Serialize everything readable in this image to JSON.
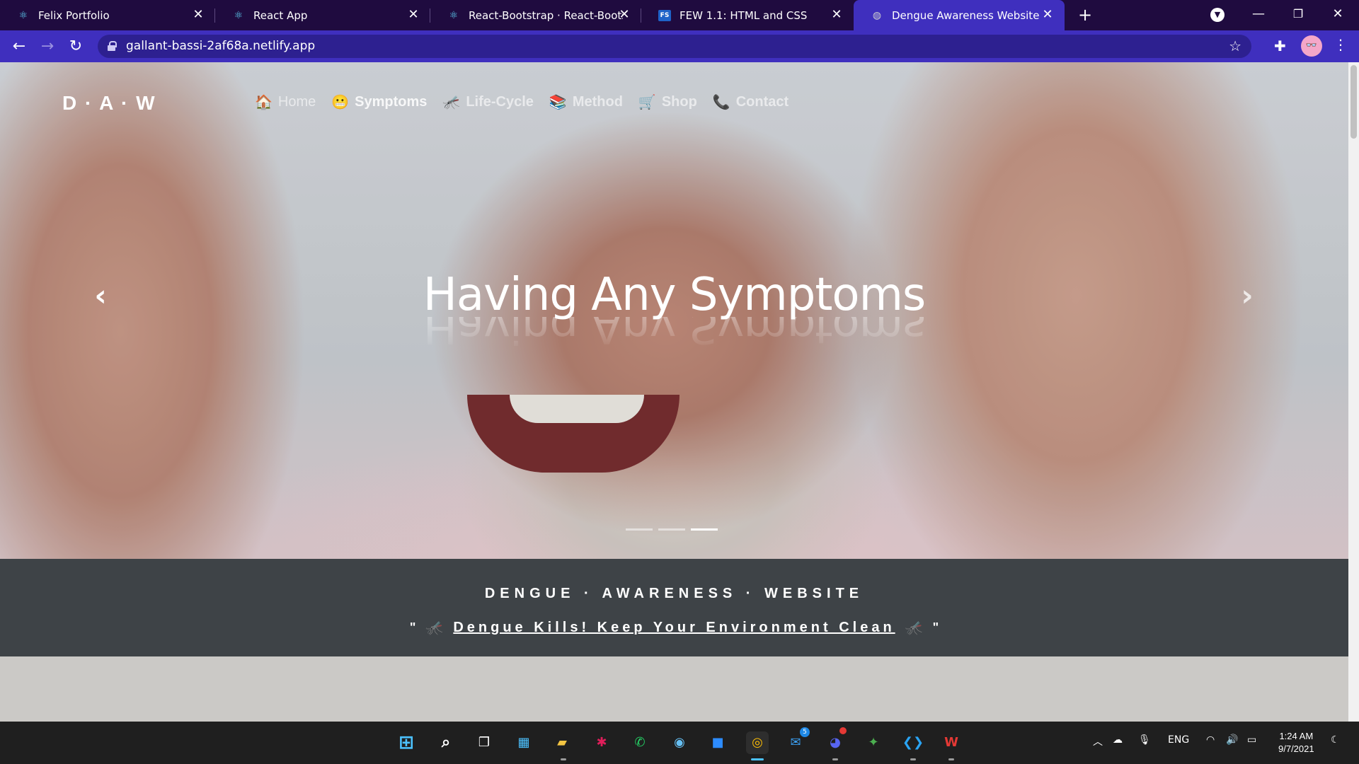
{
  "browser": {
    "tabs": [
      {
        "title": "Felix Portfolio",
        "favicon": "react-icon"
      },
      {
        "title": "React App",
        "favicon": "react-icon"
      },
      {
        "title": "React-Bootstrap · React-Bootstrap",
        "favicon": "react-icon"
      },
      {
        "title": "FEW 1.1: HTML and CSS",
        "favicon": "fs-icon",
        "favicon_text": "FS"
      },
      {
        "title": "Dengue Awareness Website",
        "favicon": "globe-icon",
        "active": true
      }
    ],
    "url": "gallant-bassi-2af68a.netlify.app",
    "accent_color": "#3f2fbe",
    "tabbar_color": "#1f0b3f"
  },
  "page": {
    "brand": "D · A · W",
    "nav": [
      {
        "label": "Home",
        "icon": "house-icon",
        "glyph": "🏠"
      },
      {
        "label": "Symptoms",
        "icon": "face-icon",
        "glyph": "😬",
        "active": true
      },
      {
        "label": "Life-Cycle",
        "icon": "mosquito-icon",
        "glyph": "🦟"
      },
      {
        "label": "Method",
        "icon": "books-icon",
        "glyph": "📚"
      },
      {
        "label": "Shop",
        "icon": "cart-icon",
        "glyph": "🛒"
      },
      {
        "label": "Contact",
        "icon": "phone-icon",
        "glyph": "📞"
      }
    ],
    "carousel": {
      "caption": "Having Any Symptoms",
      "prev_glyph": "‹",
      "next_glyph": "›",
      "slide_count": 3,
      "active_slide": 3
    },
    "banner": {
      "title": "DENGUE · AWARENESS · WEBSITE",
      "quote_open": "\"",
      "slogan": "Dengue Kills! Keep Your Environment Clean",
      "quote_close": "\"",
      "bg_color": "#3e4347"
    }
  },
  "taskbar": {
    "apps": [
      "windows-start-icon",
      "search-icon",
      "task-view-icon",
      "widgets-icon",
      "file-explorer-icon",
      "slack-icon",
      "whatsapp-icon",
      "steam-icon",
      "zoom-icon",
      "chrome-icon",
      "mail-icon",
      "discord-icon",
      "app-icon",
      "vscode-icon",
      "wps-office-icon"
    ],
    "mail_badge": "5",
    "language": "ENG",
    "time": "1:24 AM",
    "date": "9/7/2021"
  }
}
